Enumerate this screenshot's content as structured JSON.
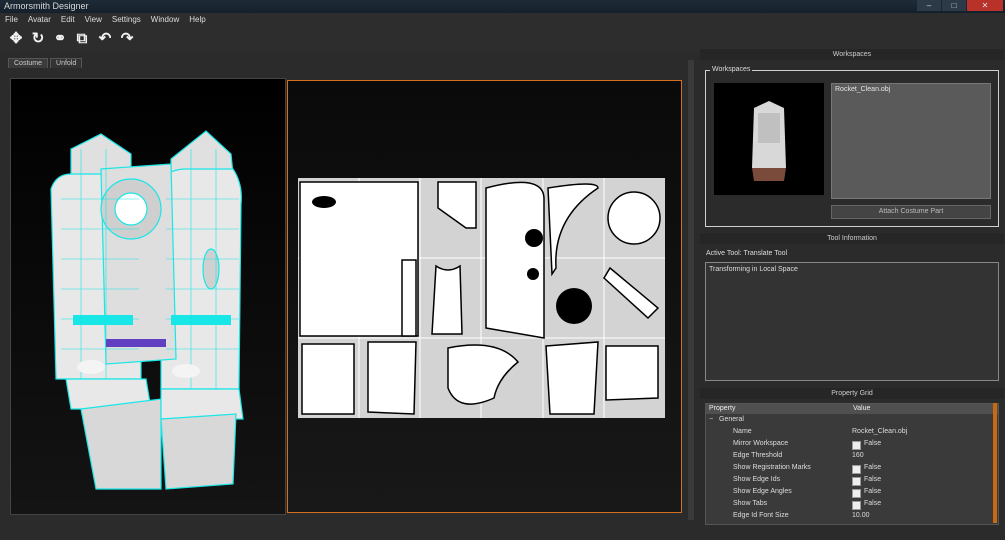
{
  "window": {
    "title": "Armorsmith Designer"
  },
  "menu": [
    "File",
    "Avatar",
    "Edit",
    "View",
    "Settings",
    "Window",
    "Help"
  ],
  "toolbar": {
    "icons": [
      "move-icon",
      "rotate-icon",
      "link-icon",
      "open-external-icon",
      "undo-icon",
      "redo-icon"
    ]
  },
  "tabs": [
    "Costume",
    "Unfold"
  ],
  "panels": {
    "workspaces_header": "Workspaces",
    "workspaces_legend": "Workspaces",
    "workspace_file": "Rocket_Clean.obj",
    "attach_button": "Attach Costume Part",
    "tool_info_header": "Tool Information",
    "active_tool": "Active Tool: Translate Tool",
    "tool_message": "Transforming in Local Space",
    "property_grid_header": "Property Grid"
  },
  "property_grid": {
    "columns": [
      "Property",
      "Value"
    ],
    "category": "General",
    "rows": [
      {
        "name": "Name",
        "value": "Rocket_Clean.obj",
        "checkbox": false
      },
      {
        "name": "Mirror Workspace",
        "value": "False",
        "checkbox": true
      },
      {
        "name": "Edge Threshold",
        "value": "160",
        "checkbox": false
      },
      {
        "name": "Show Registration Marks",
        "value": "False",
        "checkbox": true
      },
      {
        "name": "Show Edge Ids",
        "value": "False",
        "checkbox": true
      },
      {
        "name": "Show Edge Angles",
        "value": "False",
        "checkbox": true
      },
      {
        "name": "Show Tabs",
        "value": "False",
        "checkbox": true
      },
      {
        "name": "Edge Id Font Size",
        "value": "10.00",
        "checkbox": false
      }
    ]
  },
  "colors": {
    "accent_orange": "#d07020",
    "wireframe_cyan": "#19e6e6"
  }
}
